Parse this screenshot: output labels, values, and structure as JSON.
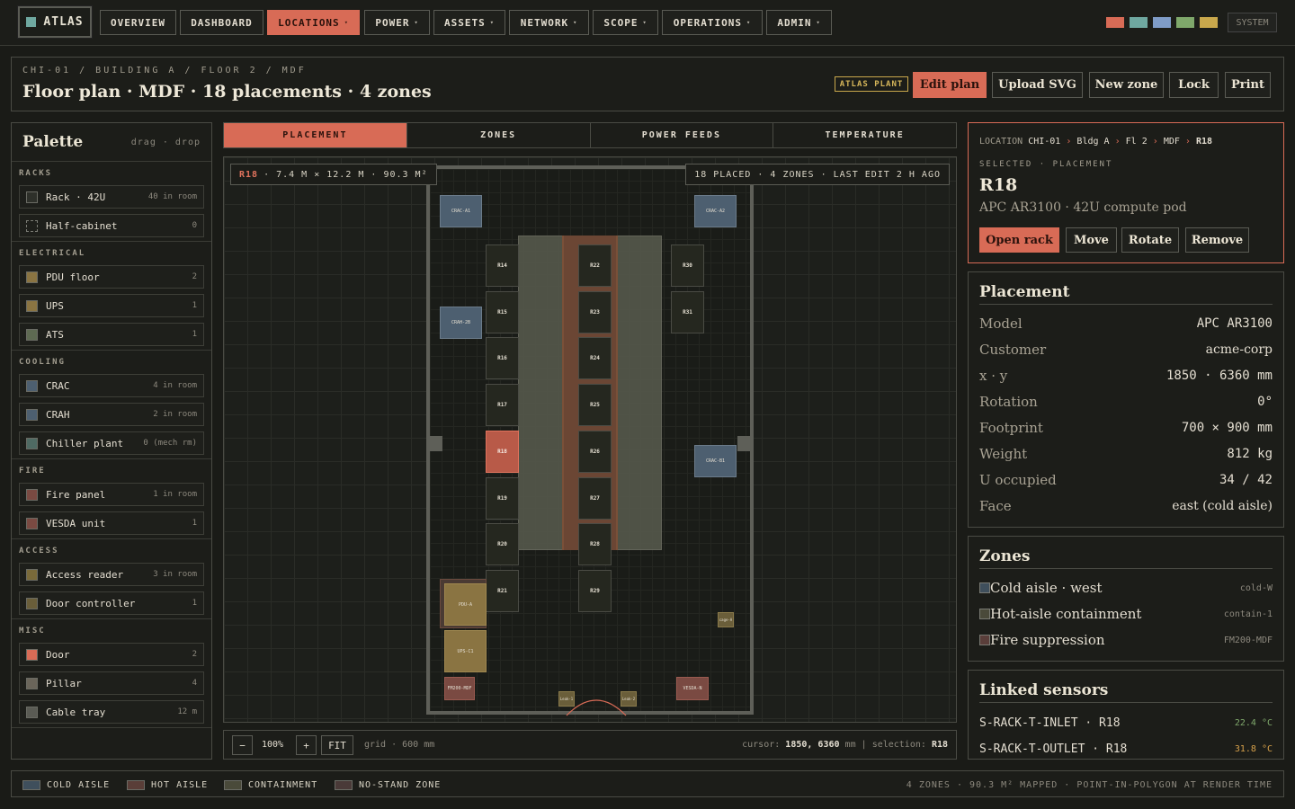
{
  "nav": {
    "brand": "ATLAS",
    "items": [
      "OVERVIEW",
      "DASHBOARD",
      "LOCATIONS",
      "POWER",
      "ASSETS",
      "NETWORK",
      "SCOPE",
      "OPERATIONS",
      "ADMIN"
    ],
    "active": "LOCATIONS",
    "swatches": [
      "#d86b56",
      "#6fa8a0",
      "#7f9cc7",
      "#7fa86b",
      "#c9a84c"
    ],
    "system_label": "SYSTEM"
  },
  "header": {
    "breadcrumb": "CHI-01 / BUILDING A / FLOOR 2 / MDF",
    "title": "Floor plan · MDF · 18 placements · 4 zones",
    "badge": "ATLAS PLANT",
    "buttons": [
      "Edit plan",
      "Upload SVG",
      "New zone",
      "Lock",
      "Print"
    ]
  },
  "palette": {
    "title": "Palette",
    "hint": "drag · drop",
    "sections": [
      {
        "title": "RACKS",
        "items": [
          {
            "label": "Rack · 42U",
            "count": "40 in room",
            "color": "#2e302a"
          },
          {
            "label": "Half-cabinet",
            "count": "0",
            "color": "dashed"
          }
        ]
      },
      {
        "title": "ELECTRICAL",
        "items": [
          {
            "label": "PDU floor",
            "count": "2",
            "color": "#8a7442"
          },
          {
            "label": "UPS",
            "count": "1",
            "color": "#8a7442"
          },
          {
            "label": "ATS",
            "count": "1",
            "color": "#5e6a52"
          }
        ]
      },
      {
        "title": "COOLING",
        "items": [
          {
            "label": "CRAC",
            "count": "4 in room",
            "color": "#4d5f70"
          },
          {
            "label": "CRAH",
            "count": "2 in room",
            "color": "#4d5f70"
          },
          {
            "label": "Chiller plant",
            "count": "0 (mech rm)",
            "color": "#4f6a63"
          }
        ]
      },
      {
        "title": "FIRE",
        "items": [
          {
            "label": "Fire panel",
            "count": "1 in room",
            "color": "#7a4a42"
          },
          {
            "label": "VESDA unit",
            "count": "1",
            "color": "#7a4a42"
          }
        ]
      },
      {
        "title": "ACCESS",
        "items": [
          {
            "label": "Access reader",
            "count": "3 in room",
            "color": "#7a6a3a"
          },
          {
            "label": "Door controller",
            "count": "1",
            "color": "#6a5e3a"
          }
        ]
      },
      {
        "title": "MISC",
        "items": [
          {
            "label": "Door",
            "count": "2",
            "color": "#d86b56"
          },
          {
            "label": "Pillar",
            "count": "4",
            "color": "#6a655a"
          },
          {
            "label": "Cable tray",
            "count": "12 m",
            "color": "#5a5b54"
          }
        ]
      }
    ]
  },
  "tabs": [
    "PLACEMENT",
    "ZONES",
    "POWER FEEDS",
    "TEMPERATURE"
  ],
  "canvas": {
    "overlay_left_sel": "R18",
    "overlay_left": "· 7.4 M × 12.2 M · 90.3 M²",
    "overlay_right": "18 PLACED · 4 ZONES · LAST EDIT 2 H AGO",
    "racks_left": [
      "R14",
      "R15",
      "R16",
      "R17",
      "R18",
      "R19",
      "R20",
      "R21"
    ],
    "racks_mid": [
      "R22",
      "R23",
      "R24",
      "R25",
      "R26",
      "R27",
      "R28",
      "R29"
    ],
    "racks_right": [
      "R30",
      "R31"
    ],
    "equipment": {
      "crac_a1": "CRAC-A1",
      "crac_a2": "CRAC-A2",
      "crah_2b": "CRAH-2B",
      "crac_b1": "CRAC-B1",
      "pdu_a": "PDU-A",
      "ups_c1": "UPS-C1",
      "fm200": "FM200-MDF",
      "vesda": "VESDA-N",
      "reader_1": "Leak-1",
      "reader_2": "Leak-2",
      "cage": "cage-A"
    },
    "selected": "R18"
  },
  "toolbar": {
    "minus": "−",
    "zoom": "100%",
    "plus": "+",
    "fit": "FIT",
    "grid": "grid · 600 mm",
    "cursor_label": "cursor:",
    "cursor_value": "1850, 6360",
    "cursor_unit": "mm",
    "separator": "|",
    "selection_label": "selection:",
    "selection_value": "R18"
  },
  "selection": {
    "location_label": "LOCATION",
    "location_path": [
      "CHI-01",
      "Bldg A",
      "Fl 2",
      "MDF",
      "R18"
    ],
    "kind": "SELECTED · PLACEMENT",
    "name": "R18",
    "subtitle": "APC AR3100 · 42U compute pod",
    "buttons": [
      "Open rack",
      "Move",
      "Rotate",
      "Remove"
    ]
  },
  "placement": {
    "title": "Placement",
    "rows": [
      {
        "k": "Model",
        "v": "APC AR3100",
        "serif": false
      },
      {
        "k": "Customer",
        "v": "acme-corp",
        "serif": true
      },
      {
        "k": "x · y",
        "v": "1850 · 6360 mm",
        "serif": false
      },
      {
        "k": "Rotation",
        "v": "0°",
        "serif": false
      },
      {
        "k": "Footprint",
        "v": "700 × 900 mm",
        "serif": false
      },
      {
        "k": "Weight",
        "v": "812 kg",
        "serif": false
      },
      {
        "k": "U occupied",
        "v": "34 / 42",
        "serif": false
      },
      {
        "k": "Face",
        "v": "east (cold aisle)",
        "serif": true
      }
    ]
  },
  "zones": {
    "title": "Zones",
    "rows": [
      {
        "name": "Cold aisle · west",
        "code": "cold-W",
        "color": "#3f4f5c"
      },
      {
        "name": "Hot-aisle containment",
        "code": "contain-1",
        "color": "#4a4a3a"
      },
      {
        "name": "Fire suppression",
        "code": "FM200-MDF",
        "color": "#5a3e3a"
      }
    ]
  },
  "sensors": {
    "title": "Linked sensors",
    "rows": [
      {
        "name": "S-RACK-T-INLET · R18",
        "value": "22.4 °C",
        "color": "#7fa86b"
      },
      {
        "name": "S-RACK-T-OUTLET · R18",
        "value": "31.8 °C",
        "color": "#d6a04a"
      }
    ]
  },
  "legend": {
    "items": [
      {
        "label": "COLD AISLE",
        "color": "#3f4f5c"
      },
      {
        "label": "HOT AISLE",
        "color": "#5a3e38"
      },
      {
        "label": "CONTAINMENT",
        "color": "#4a4a3a"
      },
      {
        "label": "NO-STAND ZONE",
        "color": "#4a3a38"
      }
    ],
    "summary": "4 ZONES · 90.3 M² MAPPED · POINT-IN-POLYGON AT RENDER TIME"
  }
}
